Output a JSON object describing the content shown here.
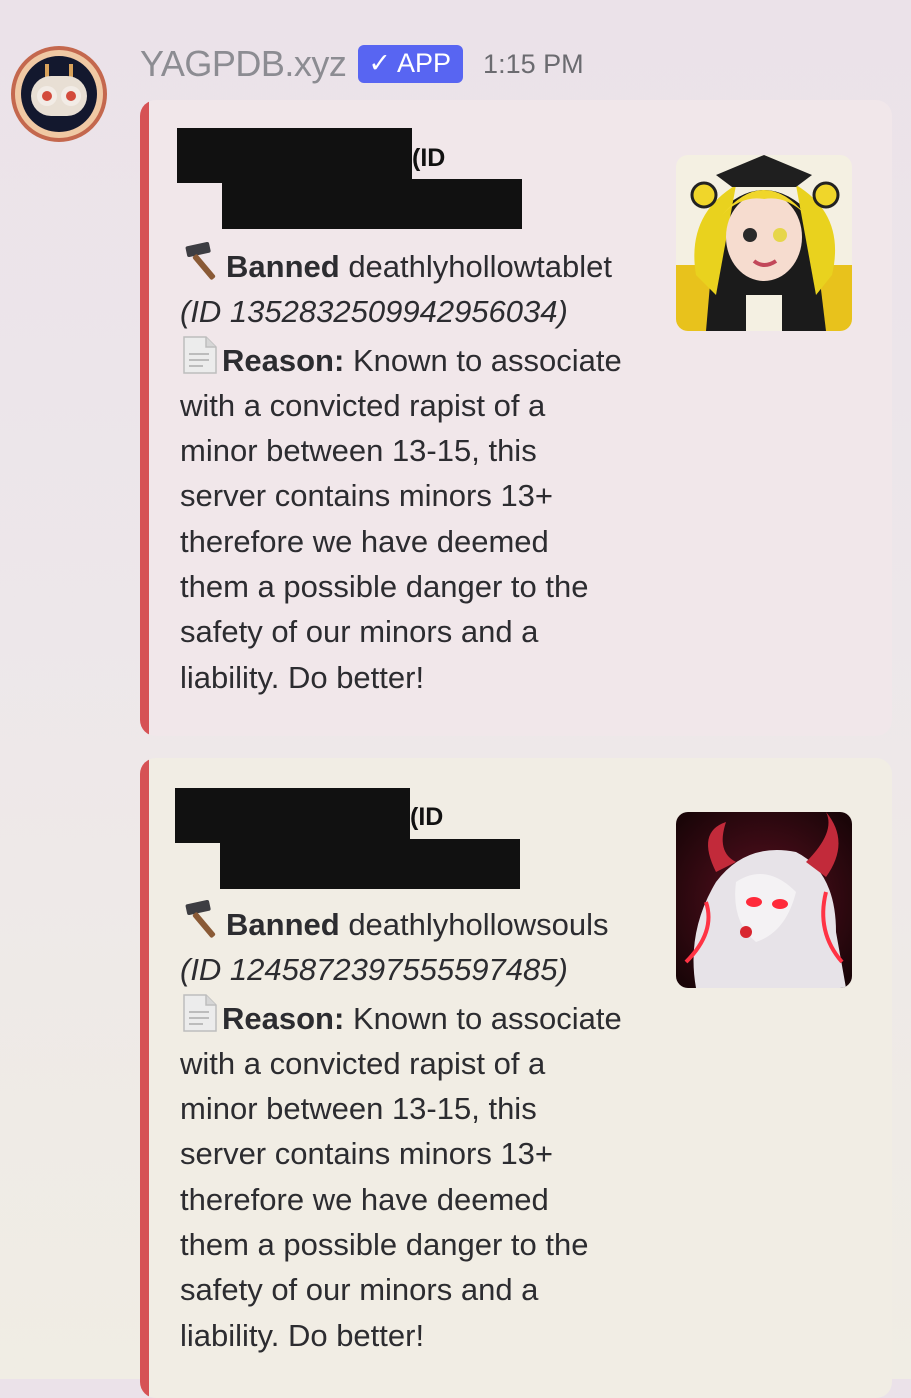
{
  "message": {
    "bot_name": "YAGPDB.xyz",
    "app_badge": "APP",
    "app_badge_check": "✓",
    "timestamp": "1:15 PM"
  },
  "embeds": [
    {
      "id_fragment": "(ID",
      "banned_label": "Banned",
      "username": "deathlyhollowtablet",
      "user_id_line": "(ID 1352832509942956034)",
      "reason_label": "Reason:",
      "reason_lines": [
        "Known to associate",
        "with a convicted rapist of a",
        "minor between 13-15, this",
        "server contains minors 13+",
        "therefore we have deemed",
        "them a possible danger to the",
        "safety of our minors and a",
        "liability. Do better!"
      ],
      "accent_color": "#d65255"
    },
    {
      "id_fragment": "(ID",
      "banned_label": "Banned",
      "username": "deathlyhollowsouls",
      "user_id_line": "(ID 1245872397555597485)",
      "reason_label": "Reason:",
      "reason_lines": [
        "Known to associate",
        "with a convicted rapist of a",
        "minor between 13-15, this",
        "server contains minors 13+",
        "therefore we have deemed",
        "them a possible danger to the",
        "safety of our minors and a",
        "liability. Do better!"
      ],
      "accent_color": "#d65255"
    }
  ],
  "icons": {
    "hammer": "hammer-icon",
    "document": "page-facing-up-icon",
    "checkmark": "checkmark-icon"
  }
}
